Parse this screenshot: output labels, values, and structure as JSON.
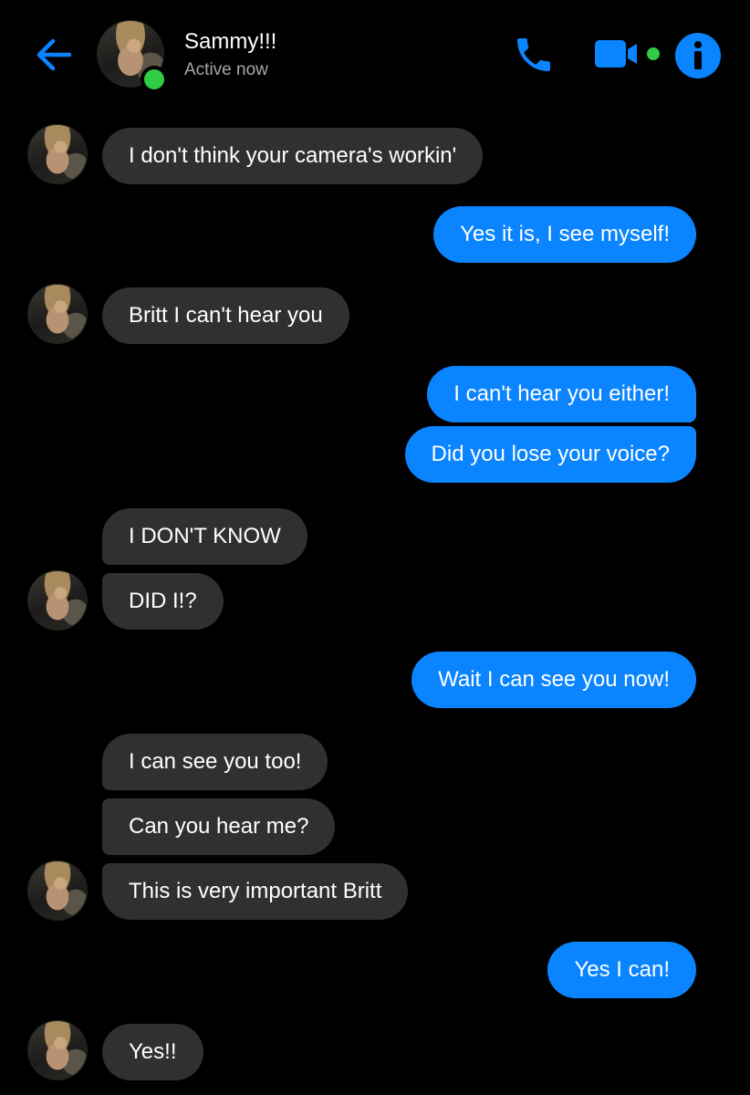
{
  "header": {
    "contact_name": "Sammy!!!",
    "status": "Active now",
    "accent_color": "#0a84ff",
    "online_color": "#31cc46",
    "icons": [
      "back-arrow-icon",
      "phone-icon",
      "video-camera-icon",
      "info-icon"
    ]
  },
  "messages": [
    {
      "from": "contact",
      "text": "I don't think your camera's workin'"
    },
    {
      "from": "me",
      "text": "Yes it is, I see myself!"
    },
    {
      "from": "contact",
      "text": "Britt I can't hear you"
    },
    {
      "from": "me",
      "text": "I can't hear you either!"
    },
    {
      "from": "me",
      "text": "Did you lose your voice?"
    },
    {
      "from": "contact",
      "text": "I DON'T KNOW"
    },
    {
      "from": "contact",
      "text": "DID I!?"
    },
    {
      "from": "me",
      "text": "Wait I can see you now!"
    },
    {
      "from": "contact",
      "text": "I can see you too!"
    },
    {
      "from": "contact",
      "text": "Can you hear me?"
    },
    {
      "from": "contact",
      "text": "This is very important Britt"
    },
    {
      "from": "me",
      "text": "Yes I can!"
    },
    {
      "from": "contact",
      "text": "Yes!!"
    }
  ]
}
